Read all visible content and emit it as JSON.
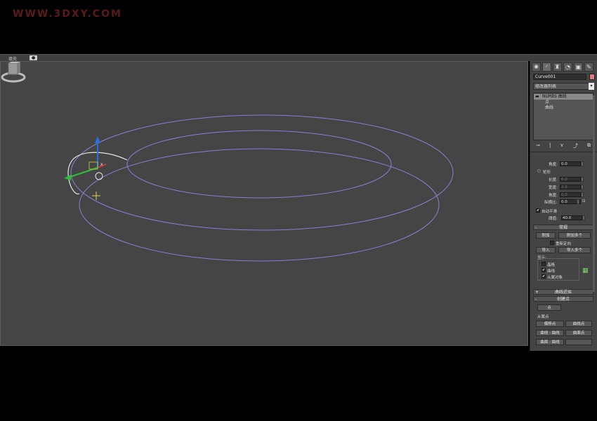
{
  "watermark": "WWW.3DXY.COM",
  "viewport": {
    "label": "填充",
    "mode_pill": "●"
  },
  "panel": {
    "tabs": [
      {
        "name": "create-tab",
        "glyph": "✺"
      },
      {
        "name": "modify-tab",
        "glyph": "◜"
      },
      {
        "name": "hierarchy-tab",
        "glyph": "♜"
      },
      {
        "name": "motion-tab",
        "glyph": "◔"
      },
      {
        "name": "display-tab",
        "glyph": "▣"
      },
      {
        "name": "utilities-tab",
        "glyph": "✎"
      }
    ],
    "object_name": "Curve001",
    "object_color": "#e07a80",
    "modifier_list": "修改器列表",
    "stack": {
      "root": "NURBS 曲线",
      "items": [
        "点",
        "曲线"
      ]
    },
    "stack_tools": [
      "⊸",
      "|",
      "⋎",
      "⤴",
      "⧉"
    ]
  },
  "rollout_top": {
    "angle_label": "角度:",
    "angle_value": "0.0",
    "rect_label": "矩形",
    "length_label": "长度:",
    "length_value": "6.0",
    "width_label": "宽度:",
    "width_value": "2.0",
    "angle2_label": "角度:",
    "angle2_value": "0.0",
    "aspect_label": "纵横比:",
    "aspect_value": "0.0",
    "auto_smooth_label": "自动平滑",
    "auto_smooth_checked": "✔",
    "threshold_label": "阈值:",
    "threshold_value": "40.0"
  },
  "general": {
    "header": "常规",
    "attach": "附加",
    "attach_multiple": "附加多个",
    "reorient": "重新定向",
    "import": "导入",
    "import_multiple": "导入多个",
    "display_label": "显示:",
    "lattice": "晶格",
    "curves": "曲线",
    "dependents": "从属对象"
  },
  "curve_approx": {
    "header": "曲线近似"
  },
  "create_points": {
    "header": "创建点",
    "point": "点",
    "dependent_points_label": "从属点",
    "offset_point": "偏移点",
    "curve_point": "曲线点",
    "curve_curve": "曲线 - 曲线",
    "surface_point": "曲面点",
    "surface_curve": "曲面 - 曲线"
  },
  "colors": {
    "curve_purple": "#8e7fd6",
    "selected_curve": "#e6e6e6",
    "viewport_bg": "#454545"
  }
}
